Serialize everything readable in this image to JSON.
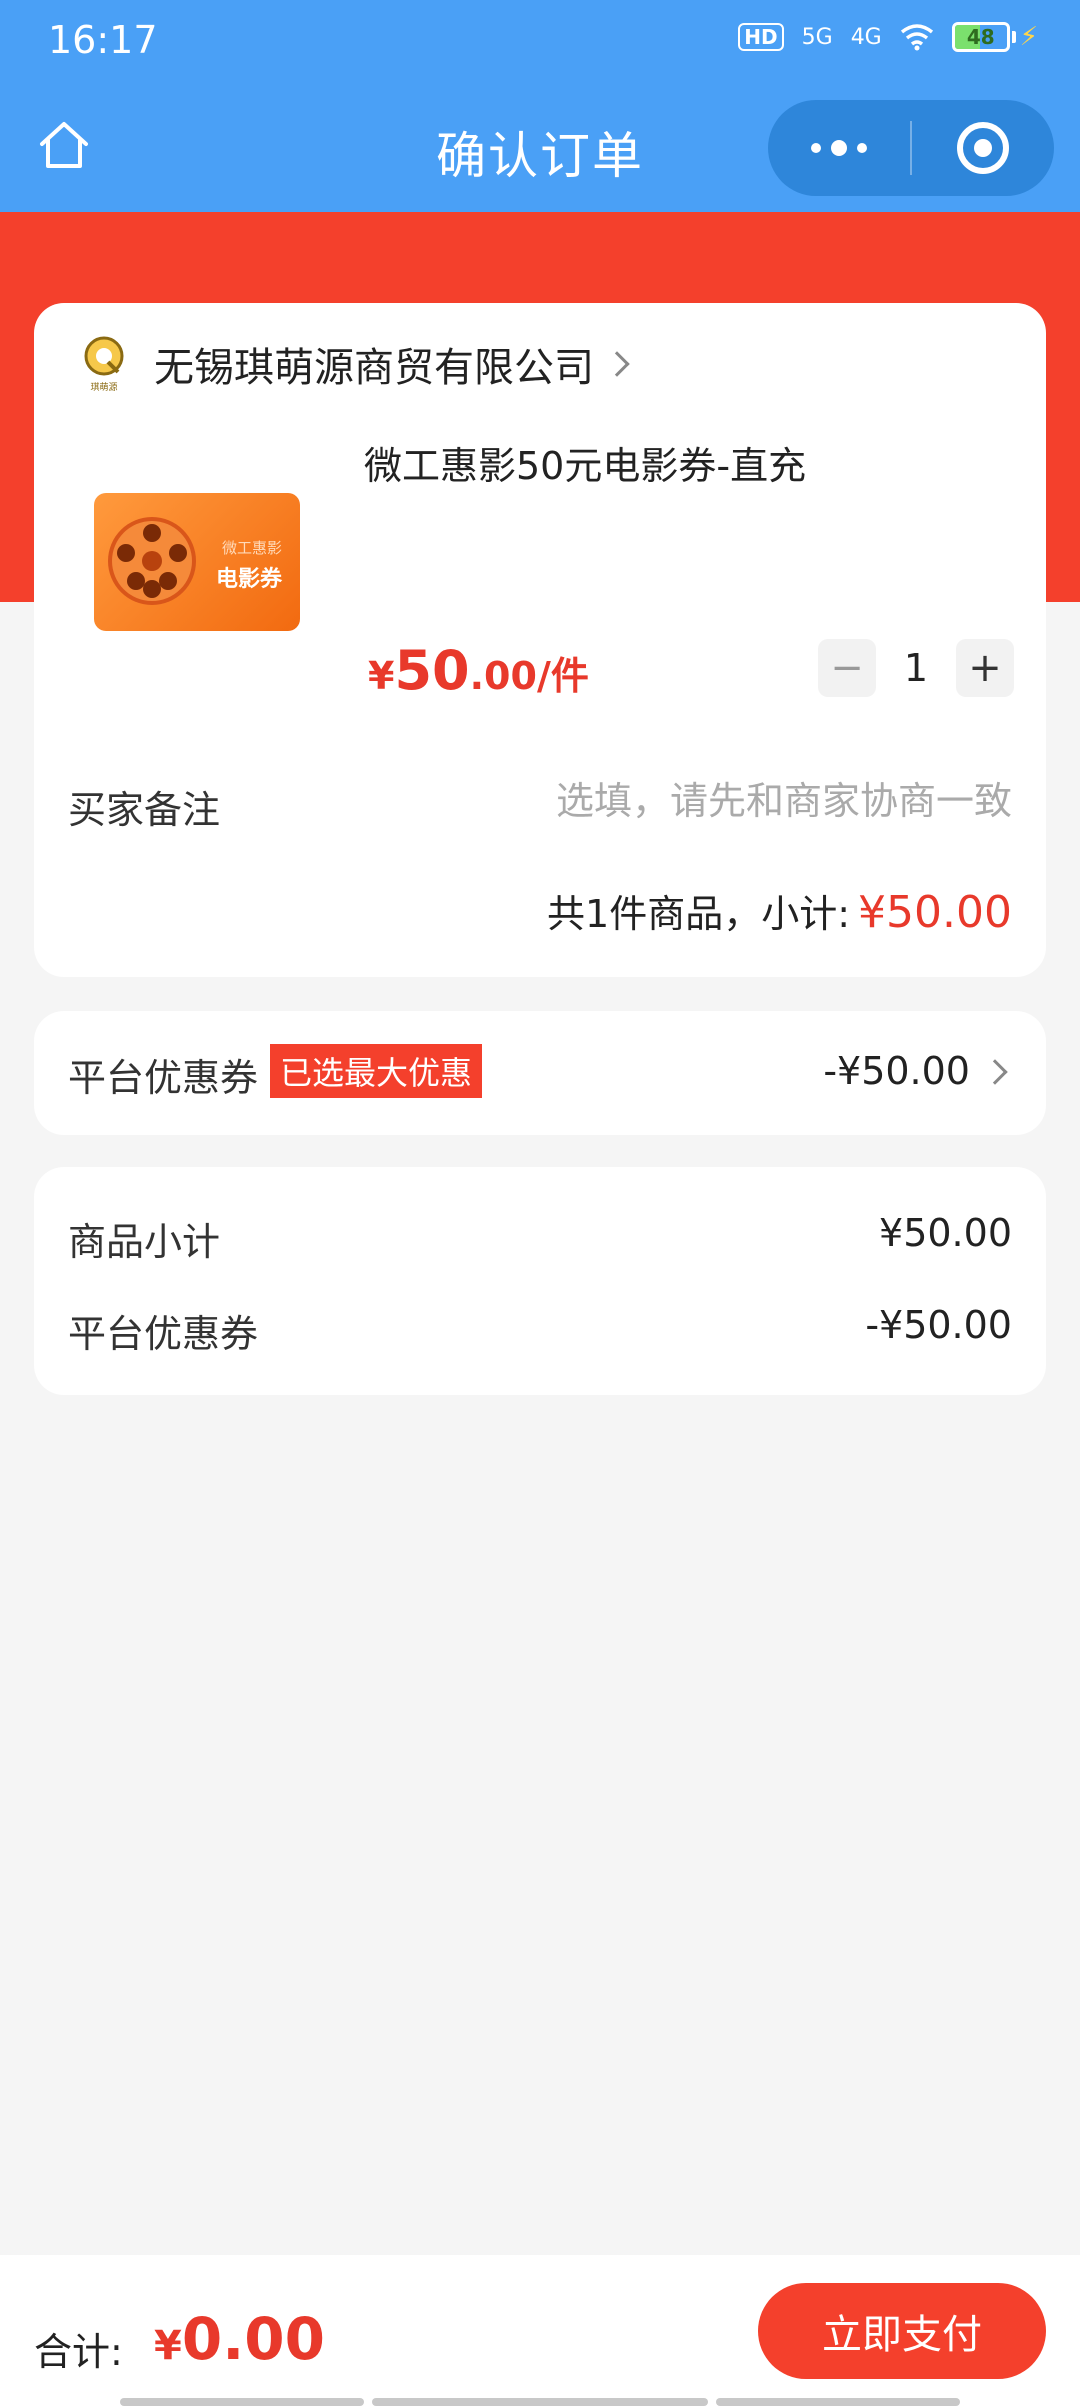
{
  "status_bar": {
    "time": "16:17",
    "hd": "HD",
    "net1": "5G",
    "net2": "4G",
    "battery": "48",
    "battery_level": 0.48
  },
  "nav": {
    "title": "确认订单",
    "home_icon": "home-icon",
    "more_icon": "more-dots-icon",
    "close_icon": "target-close-icon"
  },
  "order": {
    "store_name": "无锡琪萌源商贸有限公司",
    "store_logo_text": "琪萌源",
    "product": {
      "title": "微工惠影50元电影券-直充",
      "image_caption_small": "微工惠影",
      "image_caption_large": "电影券",
      "price_yen": "¥",
      "price_int": "50",
      "price_dec": ".00",
      "price_unit": "/件",
      "quantity": "1",
      "minus": "−",
      "plus": "+"
    },
    "remark_label": "买家备注",
    "remark_placeholder": "选填，请先和商家协商一致",
    "subtotal_text": "共1件商品，小计:",
    "subtotal_amount": "¥50.00"
  },
  "coupon": {
    "label": "平台优惠券",
    "badge": "已选最大优惠",
    "amount": "-¥50.00"
  },
  "summary": {
    "rows": [
      {
        "label": "商品小计",
        "value": "¥50.00"
      },
      {
        "label": "平台优惠券",
        "value": "-¥50.00"
      }
    ]
  },
  "footer": {
    "total_label": "合计:",
    "total_yen": "¥",
    "total_value": "0.00",
    "pay_button": "立即支付"
  },
  "colors": {
    "nav_bg": "#4aa0f6",
    "accent_red": "#f4402c",
    "price_red": "#e8392b"
  }
}
